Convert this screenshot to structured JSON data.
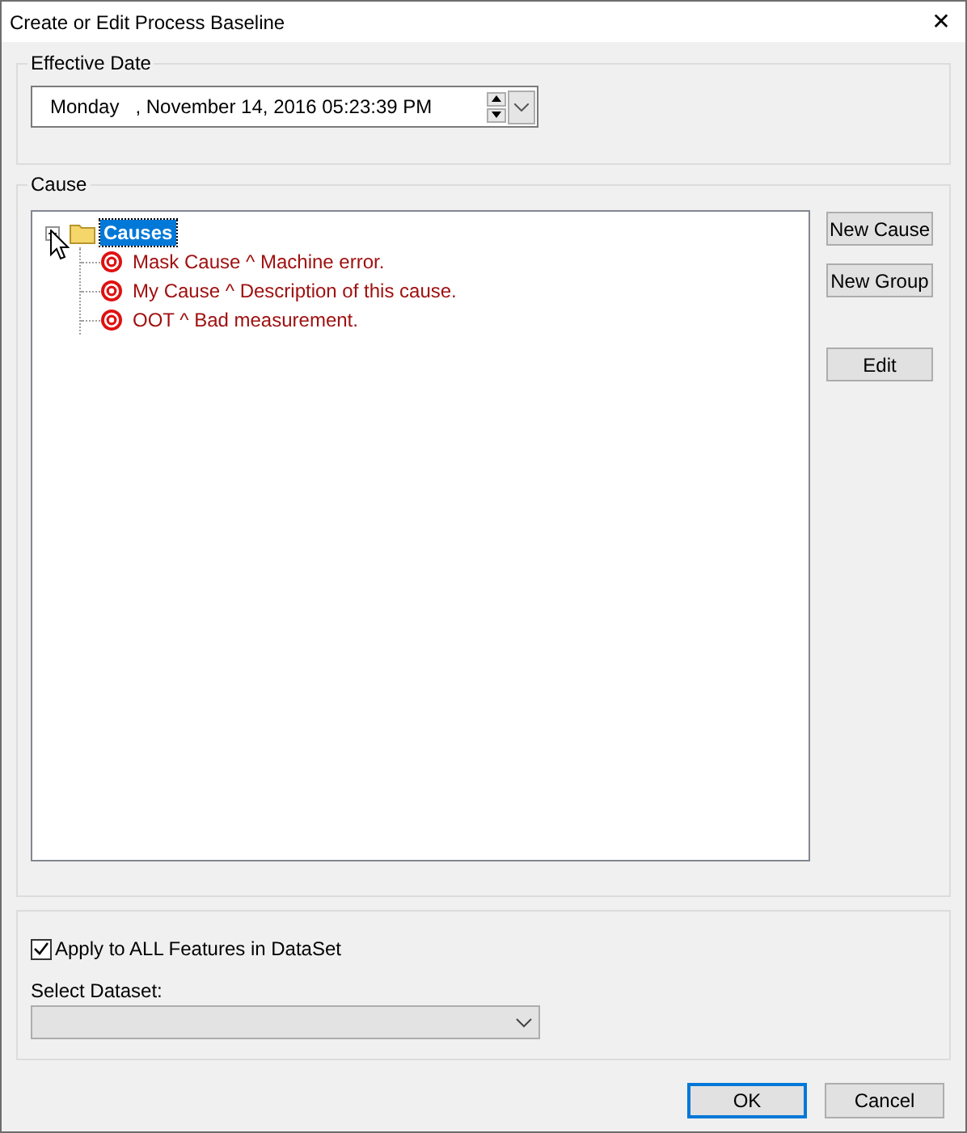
{
  "window": {
    "title": "Create or Edit Process Baseline",
    "close": "✕"
  },
  "effective_date": {
    "label": "Effective Date",
    "value": "Monday   , November 14, 2016 05:23:39 PM"
  },
  "cause": {
    "label": "Cause",
    "tree": {
      "label": "Causes",
      "expanded": true,
      "selected": true,
      "children": [
        {
          "label": "Mask Cause ^ Machine error.",
          "selected": false
        },
        {
          "label": "My Cause ^ Description of this cause.",
          "selected": false
        },
        {
          "label": "OOT ^ Bad measurement.",
          "selected": false
        }
      ]
    },
    "buttons": [
      "New Cause",
      "New Group",
      "Edit"
    ]
  },
  "options": {
    "apply_all": {
      "label": "Apply to ALL Features in DataSet",
      "checked": true
    },
    "dataset": {
      "label": "Select Dataset:",
      "disabled": true
    }
  },
  "footer": {
    "buttons": [
      {
        "label": "OK",
        "default": true
      },
      {
        "label": "Cancel",
        "default": false
      }
    ]
  }
}
